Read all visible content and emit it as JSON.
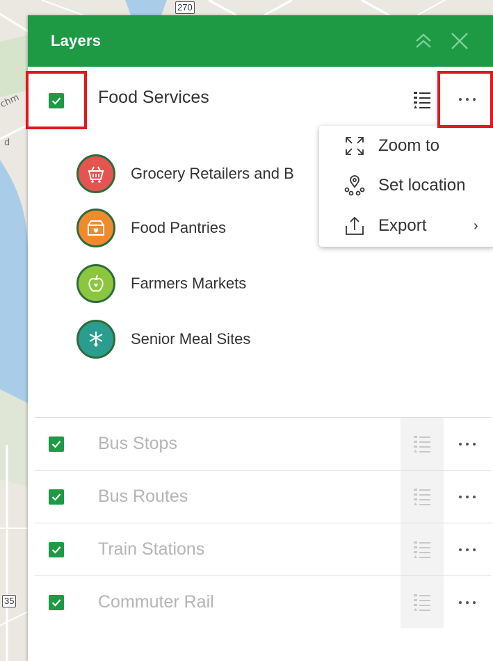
{
  "map": {
    "labels": {
      "partial_left": "chm",
      "partial_d": "d"
    },
    "shields": {
      "top": "270",
      "bottom": "35"
    }
  },
  "panel": {
    "title": "Layers",
    "header_color": "#1e9a45",
    "icons": {
      "collapse": "double-chevron-up-icon",
      "close": "close-icon"
    }
  },
  "layers": [
    {
      "name": "Food Services",
      "checked": true,
      "visible_style": "active"
    },
    {
      "name": "Bus Stops",
      "checked": true,
      "visible_style": "dimmed"
    },
    {
      "name": "Bus Routes",
      "checked": true,
      "visible_style": "dimmed"
    },
    {
      "name": "Train Stations",
      "checked": true,
      "visible_style": "dimmed"
    },
    {
      "name": "Commuter Rail",
      "checked": true,
      "visible_style": "dimmed"
    }
  ],
  "legend": [
    {
      "label": "Grocery Retailers and B",
      "color": "#e45552",
      "icon": "shopping-basket-icon"
    },
    {
      "label": "Food Pantries",
      "color": "#f08a2e",
      "icon": "food-box-icon"
    },
    {
      "label": "Farmers Markets",
      "color": "#8cc63f",
      "icon": "apple-icon"
    },
    {
      "label": "Senior Meal Sites",
      "color": "#2a9d8f",
      "icon": "utensils-icon"
    }
  ],
  "context_menu": {
    "items": [
      {
        "label": "Zoom to",
        "icon": "zoom-to-icon"
      },
      {
        "label": "Set location",
        "icon": "set-location-icon"
      },
      {
        "label": "Export",
        "icon": "export-icon",
        "has_submenu": true,
        "chevron": "›"
      }
    ]
  },
  "colors": {
    "accent": "#1e9a45",
    "highlight": "#e3161e"
  }
}
